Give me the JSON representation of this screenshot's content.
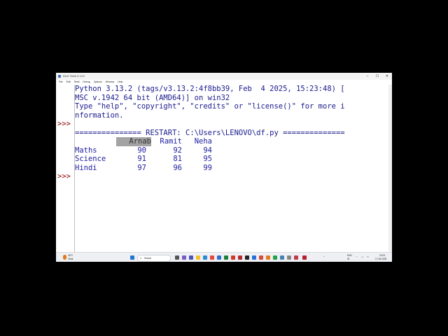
{
  "window": {
    "title": "IDLE Shell 3.13.2",
    "controls": {
      "minimize": "–",
      "maximize": "☐",
      "close": "✕"
    }
  },
  "menu": [
    "File",
    "Edit",
    "Shell",
    "Debug",
    "Options",
    "Window",
    "Help"
  ],
  "shell": {
    "banner": [
      "Python 3.13.2 (tags/v3.13.2:4f8bb39, Feb  4 2025, 15:23:48) [",
      "MSC v.1942 64 bit (AMD64)] on win32",
      "Type \"help\", \"copyright\", \"credits\" or \"license()\" for more i",
      "nformation."
    ],
    "prompt": ">>>",
    "restart_line": "=============== RESTART: C:\\Users\\LENOVO\\df.py ==============",
    "table": {
      "columns": [
        "Arnab",
        "Ramit",
        "Neha"
      ],
      "rows": [
        {
          "label": "Maths",
          "values": [
            "90",
            "92",
            "94"
          ]
        },
        {
          "label": "Science",
          "values": [
            "91",
            "81",
            "95"
          ]
        },
        {
          "label": "Hindi",
          "values": [
            "97",
            "96",
            "99"
          ]
        }
      ]
    }
  },
  "taskbar": {
    "weather_temp": "18°C",
    "weather_text": "Clear",
    "search_placeholder": "Search",
    "lang_top": "ENG",
    "lang_bottom": "IN",
    "time": "22:03",
    "date": "17-06-2025"
  },
  "icons": [
    "windows-icon",
    "search-icon",
    "chrome-icon",
    "explorer-icon",
    "store-icon",
    "teams-icon",
    "edge-icon"
  ]
}
